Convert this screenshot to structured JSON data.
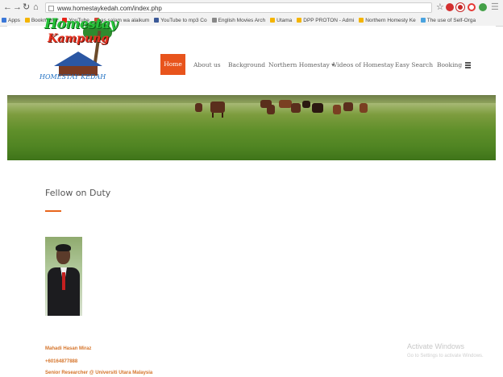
{
  "browser": {
    "url": "www.homestaykedah.com/index.php",
    "bookmarks": [
      {
        "label": "Apps",
        "color": "#3b78d8"
      },
      {
        "label": "Bookmarks",
        "color": "#f4b400"
      },
      {
        "label": "YouTube",
        "color": "#e62117"
      },
      {
        "label": "as salam wa alaikum",
        "color": "#d44638"
      },
      {
        "label": "YouTube to mp3 Co",
        "color": "#3b5998"
      },
      {
        "label": "English Movies Arch",
        "color": "#888888"
      },
      {
        "label": "Utama",
        "color": "#f4b400"
      },
      {
        "label": "DPP PROTON - Admi",
        "color": "#f4b400"
      },
      {
        "label": "Northern Homesty Ke",
        "color": "#f4b400"
      },
      {
        "label": "The use of Self-Orga",
        "color": "#4aa3df"
      }
    ]
  },
  "site": {
    "logo": {
      "line1": "Homestay",
      "line2": "Kampung",
      "line3": "HOMESTAY KEDAH"
    },
    "nav": [
      {
        "label": "Home",
        "active": true
      },
      {
        "label": "About us"
      },
      {
        "label": "Background"
      },
      {
        "label": "Northern Homestay ▾"
      },
      {
        "label": "Videos of Homestay"
      },
      {
        "label": "Easy Search"
      },
      {
        "label": "Booking"
      }
    ],
    "accent_color": "#e8541c"
  },
  "content": {
    "title": "Fellow on Duty",
    "person": {
      "name": "Mahadi Hasan Miraz",
      "phone": "+60164877888",
      "role": "Senior Researcher @ Universiti Utara Malaysia"
    }
  },
  "watermark": {
    "line1": "Activate Windows",
    "line2": "Go to Settings to activate Windows."
  }
}
